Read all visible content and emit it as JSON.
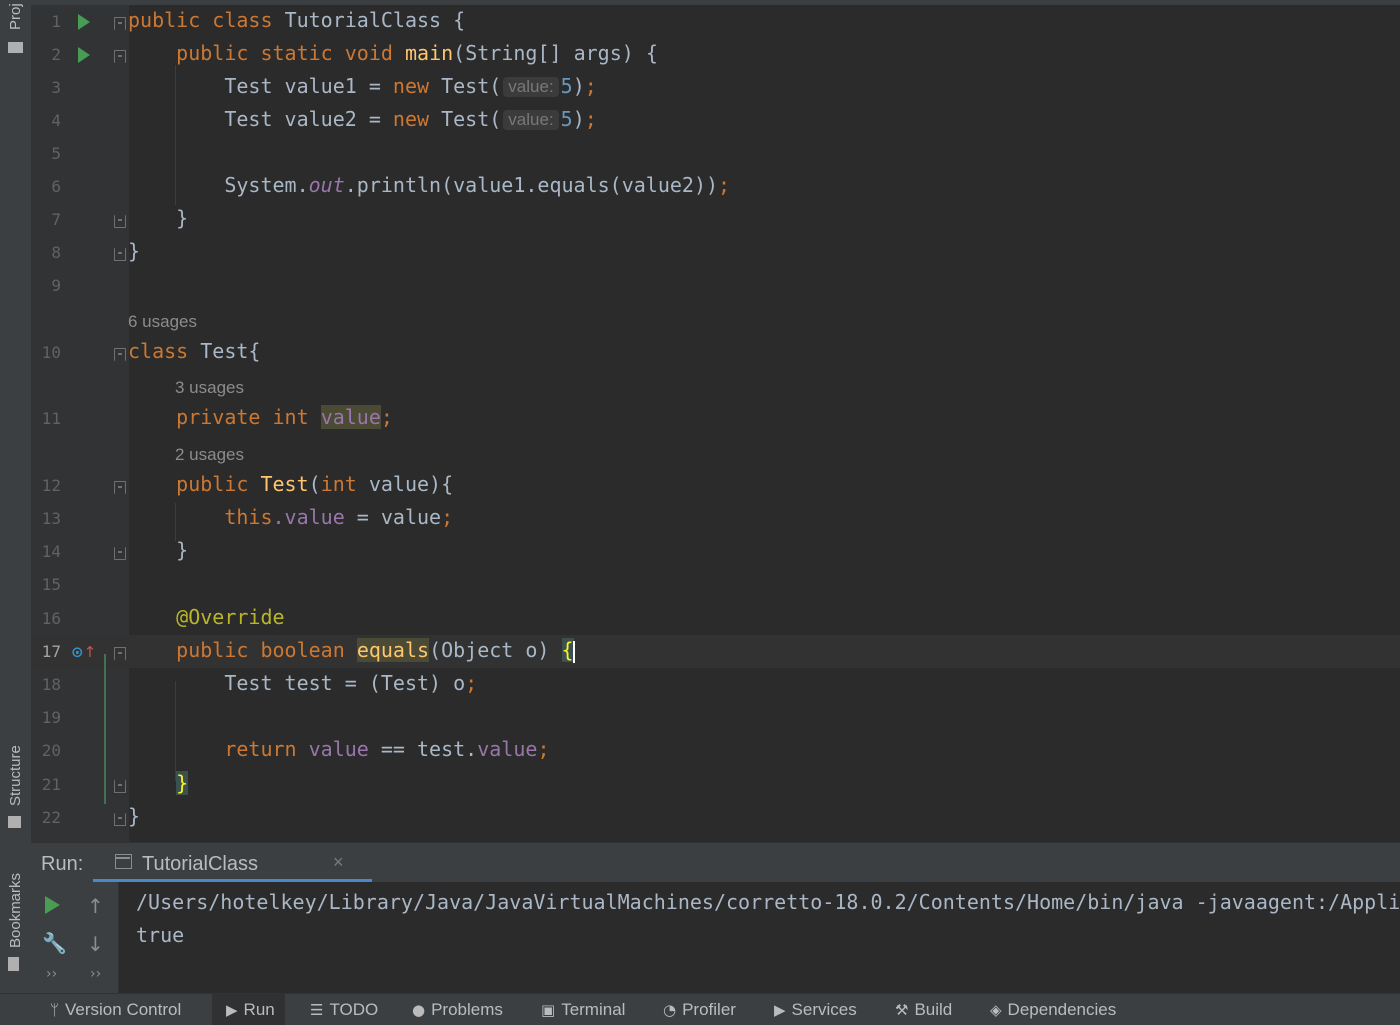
{
  "sidebar": {
    "project_label": "Proj",
    "structure_label": "Structure",
    "bookmarks_label": "Bookmarks"
  },
  "editor": {
    "lines": [
      {
        "n": "1"
      },
      {
        "n": "2"
      },
      {
        "n": "3"
      },
      {
        "n": "4"
      },
      {
        "n": "5"
      },
      {
        "n": "6"
      },
      {
        "n": "7"
      },
      {
        "n": "8"
      },
      {
        "n": "9"
      },
      {
        "n": "10"
      },
      {
        "n": "11"
      },
      {
        "n": "12"
      },
      {
        "n": "13"
      },
      {
        "n": "14"
      },
      {
        "n": "15"
      },
      {
        "n": "16"
      },
      {
        "n": "17"
      },
      {
        "n": "18"
      },
      {
        "n": "19"
      },
      {
        "n": "20"
      },
      {
        "n": "21"
      },
      {
        "n": "22"
      }
    ],
    "tokens": {
      "public": "public",
      "class": "class",
      "static": "static",
      "void": "void",
      "new": "new",
      "private": "private",
      "int": "int",
      "boolean": "boolean",
      "return": "return",
      "this": "this",
      "tutorial_class": "TutorialClass",
      "main": "main",
      "main_params": "(String[] args) {",
      "test": "Test",
      "test_brace": "Test{",
      "value1_decl": "Test value1 = ",
      "value2_decl": "Test value2 = ",
      "test_open": "Test(",
      "hint_value": "value:",
      "five": "5",
      "close_paren": ")",
      "semicolon": ";",
      "system": "System.",
      "out": "out",
      "println": ".println(value1.equals(value2))",
      "close_brace": "}",
      "open_brace": " {",
      "value": "value",
      "test_ctor": "Test",
      "ctor_params_open": "(",
      "ctor_params_close": " value){",
      "dot_value": ".value",
      "assign_value": " = value",
      "override": "@Override",
      "equals": "equals",
      "equals_params": "(Object o) ",
      "brace_open": "{",
      "cast_line": "Test test = (Test) o",
      "return_value": "value",
      "eq_test": " == test.",
      "test_value": "value"
    },
    "usages": {
      "class_test": "6 usages",
      "field_value": "3 usages",
      "ctor_test": "2 usages"
    }
  },
  "run": {
    "label": "Run:",
    "tab_name": "TutorialClass",
    "output": [
      "/Users/hotelkey/Library/Java/JavaVirtualMachines/corretto-18.0.2/Contents/Home/bin/java -javaagent:/Applicat",
      "true"
    ]
  },
  "statusbar": {
    "items": [
      {
        "label": "Version Control",
        "icon": "branch-icon"
      },
      {
        "label": "Run",
        "icon": "run-icon"
      },
      {
        "label": "TODO",
        "icon": "list-icon"
      },
      {
        "label": "Problems",
        "icon": "problems-icon"
      },
      {
        "label": "Terminal",
        "icon": "terminal-icon"
      },
      {
        "label": "Profiler",
        "icon": "profiler-icon"
      },
      {
        "label": "Services",
        "icon": "services-icon"
      },
      {
        "label": "Build",
        "icon": "hammer-icon"
      },
      {
        "label": "Dependencies",
        "icon": "dependencies-icon"
      }
    ]
  }
}
